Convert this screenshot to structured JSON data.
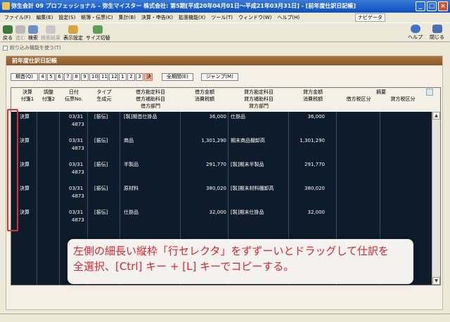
{
  "window": {
    "title": "弥生会計 09 プロフェッショナル - 弥生マイスター 株式会社: 第5期[平成20年04月01日～平成21年03月31日] - [前年度仕訳日記帳]",
    "controls": [
      "_",
      "□",
      "×"
    ]
  },
  "menu": [
    "ファイル(F)",
    "編集(E)",
    "設定(S)",
    "帳簿・伝票(C)",
    "集計(B)",
    "決算・申告(K)",
    "拡張機能(X)",
    "ツール(T)",
    "ウィンドウ(W)",
    "ヘルプ(H)"
  ],
  "navi_label": "ナビゲータ",
  "toolbar": {
    "back": "戻る",
    "next": "進む",
    "search": "検索",
    "search_result": "検索結果",
    "display_settings": "表示設定",
    "size_switch": "サイズ切替",
    "help": "ヘルプ",
    "close": "閉じる"
  },
  "filter_label": "絞り込み機能を使う(T)",
  "panel_title": "前年度仕訳日記帳",
  "periods": {
    "first": "期首(Q)",
    "months": [
      "4",
      "5",
      "6",
      "7",
      "8",
      "9",
      "10",
      "11",
      "12",
      "1",
      "2",
      "3",
      "決"
    ],
    "selected": "決",
    "all_period": "全期間(E)",
    "jump": "ジャンプ(M)"
  },
  "table": {
    "headers_row1": [
      "決算",
      "調整",
      "日付",
      "タイプ",
      "借方勘定科目",
      "借方金額",
      "貸方勘定科目",
      "貸方金額",
      "摘要"
    ],
    "headers_row2": [
      "付箋1",
      "付箋2",
      "伝票No.",
      "生成元",
      "借方補助科目",
      "消費税額",
      "貸方補助科目",
      "消費税額",
      "借方税区分",
      "貸方税区分"
    ],
    "headers_row3": [
      "借方部門",
      "貸方部門"
    ],
    "rows": [
      {
        "kessan": "決算",
        "date": "03/31",
        "no": "4873",
        "type": "[振伝]",
        "debit_account": "[製]期首仕掛品",
        "debit_amount": "36,000",
        "credit_account": "仕掛品",
        "credit_amount": "36,000"
      },
      {
        "kessan": "決算",
        "date": "03/31",
        "no": "4873",
        "type": "[振伝]",
        "debit_account": "商品",
        "debit_amount": "1,301,290",
        "credit_account": "期末商品棚卸高",
        "credit_amount": "1,301,290"
      },
      {
        "kessan": "決算",
        "date": "03/31",
        "no": "4873",
        "type": "[振伝]",
        "debit_account": "半製品",
        "debit_amount": "291,770",
        "credit_account": "[製]期末半製品",
        "credit_amount": "291,770"
      },
      {
        "kessan": "決算",
        "date": "03/31",
        "no": "4873",
        "type": "[振伝]",
        "debit_account": "原材料",
        "debit_amount": "380,020",
        "credit_account": "[製]期末材料棚卸高",
        "credit_amount": "380,020"
      },
      {
        "kessan": "決算",
        "date": "03/31",
        "no": "4873",
        "type": "[振伝]",
        "debit_account": "仕掛品",
        "debit_amount": "32,000",
        "credit_account": "[製]期末仕掛品",
        "credit_amount": "32,000"
      }
    ]
  },
  "callout": {
    "line1": "左側の細長い縦枠「行セレクタ」をずずーいとドラッグして仕訳を",
    "line2": "全選択、[Ctrl] キー + [L] キーでコピーする。"
  },
  "colors": {
    "accent": "#e23030",
    "panel_header": "#8a5a2b",
    "grid_bg": "#0d1b2a",
    "selected_period": "#f3b98a"
  }
}
